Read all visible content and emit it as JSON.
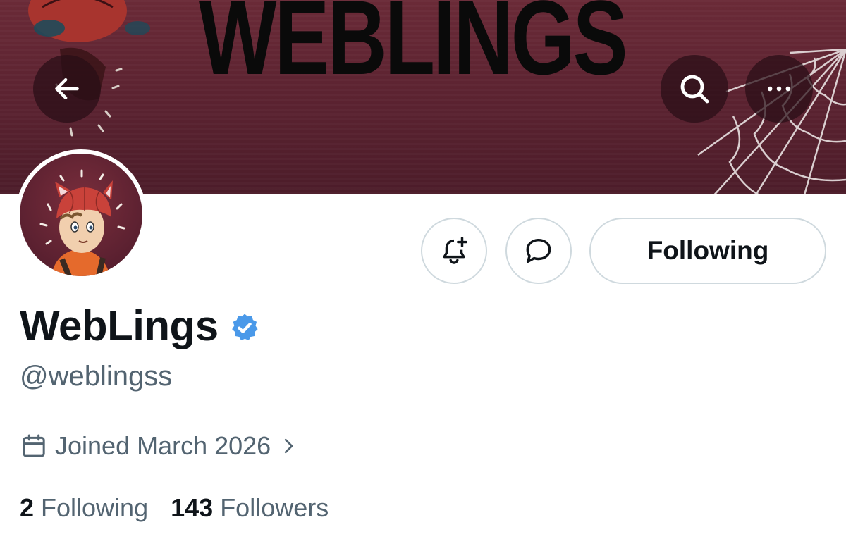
{
  "banner": {
    "title": "WEBLINGS",
    "background_color": "#5a2230"
  },
  "header": {
    "back_icon": "arrow-left-icon",
    "search_icon": "search-icon",
    "more_icon": "more-horizontal-icon"
  },
  "profile": {
    "display_name": "WebLings",
    "verified": true,
    "verified_color": "#4a99e9",
    "handle": "@weblingss",
    "joined": "Joined March 2026",
    "joined_icon": "calendar-icon"
  },
  "actions": {
    "notify_icon": "bell-plus-icon",
    "message_icon": "message-bubble-icon",
    "following_label": "Following"
  },
  "stats": {
    "following_count": "2",
    "following_label": "Following",
    "followers_count": "143",
    "followers_label": "Followers"
  }
}
